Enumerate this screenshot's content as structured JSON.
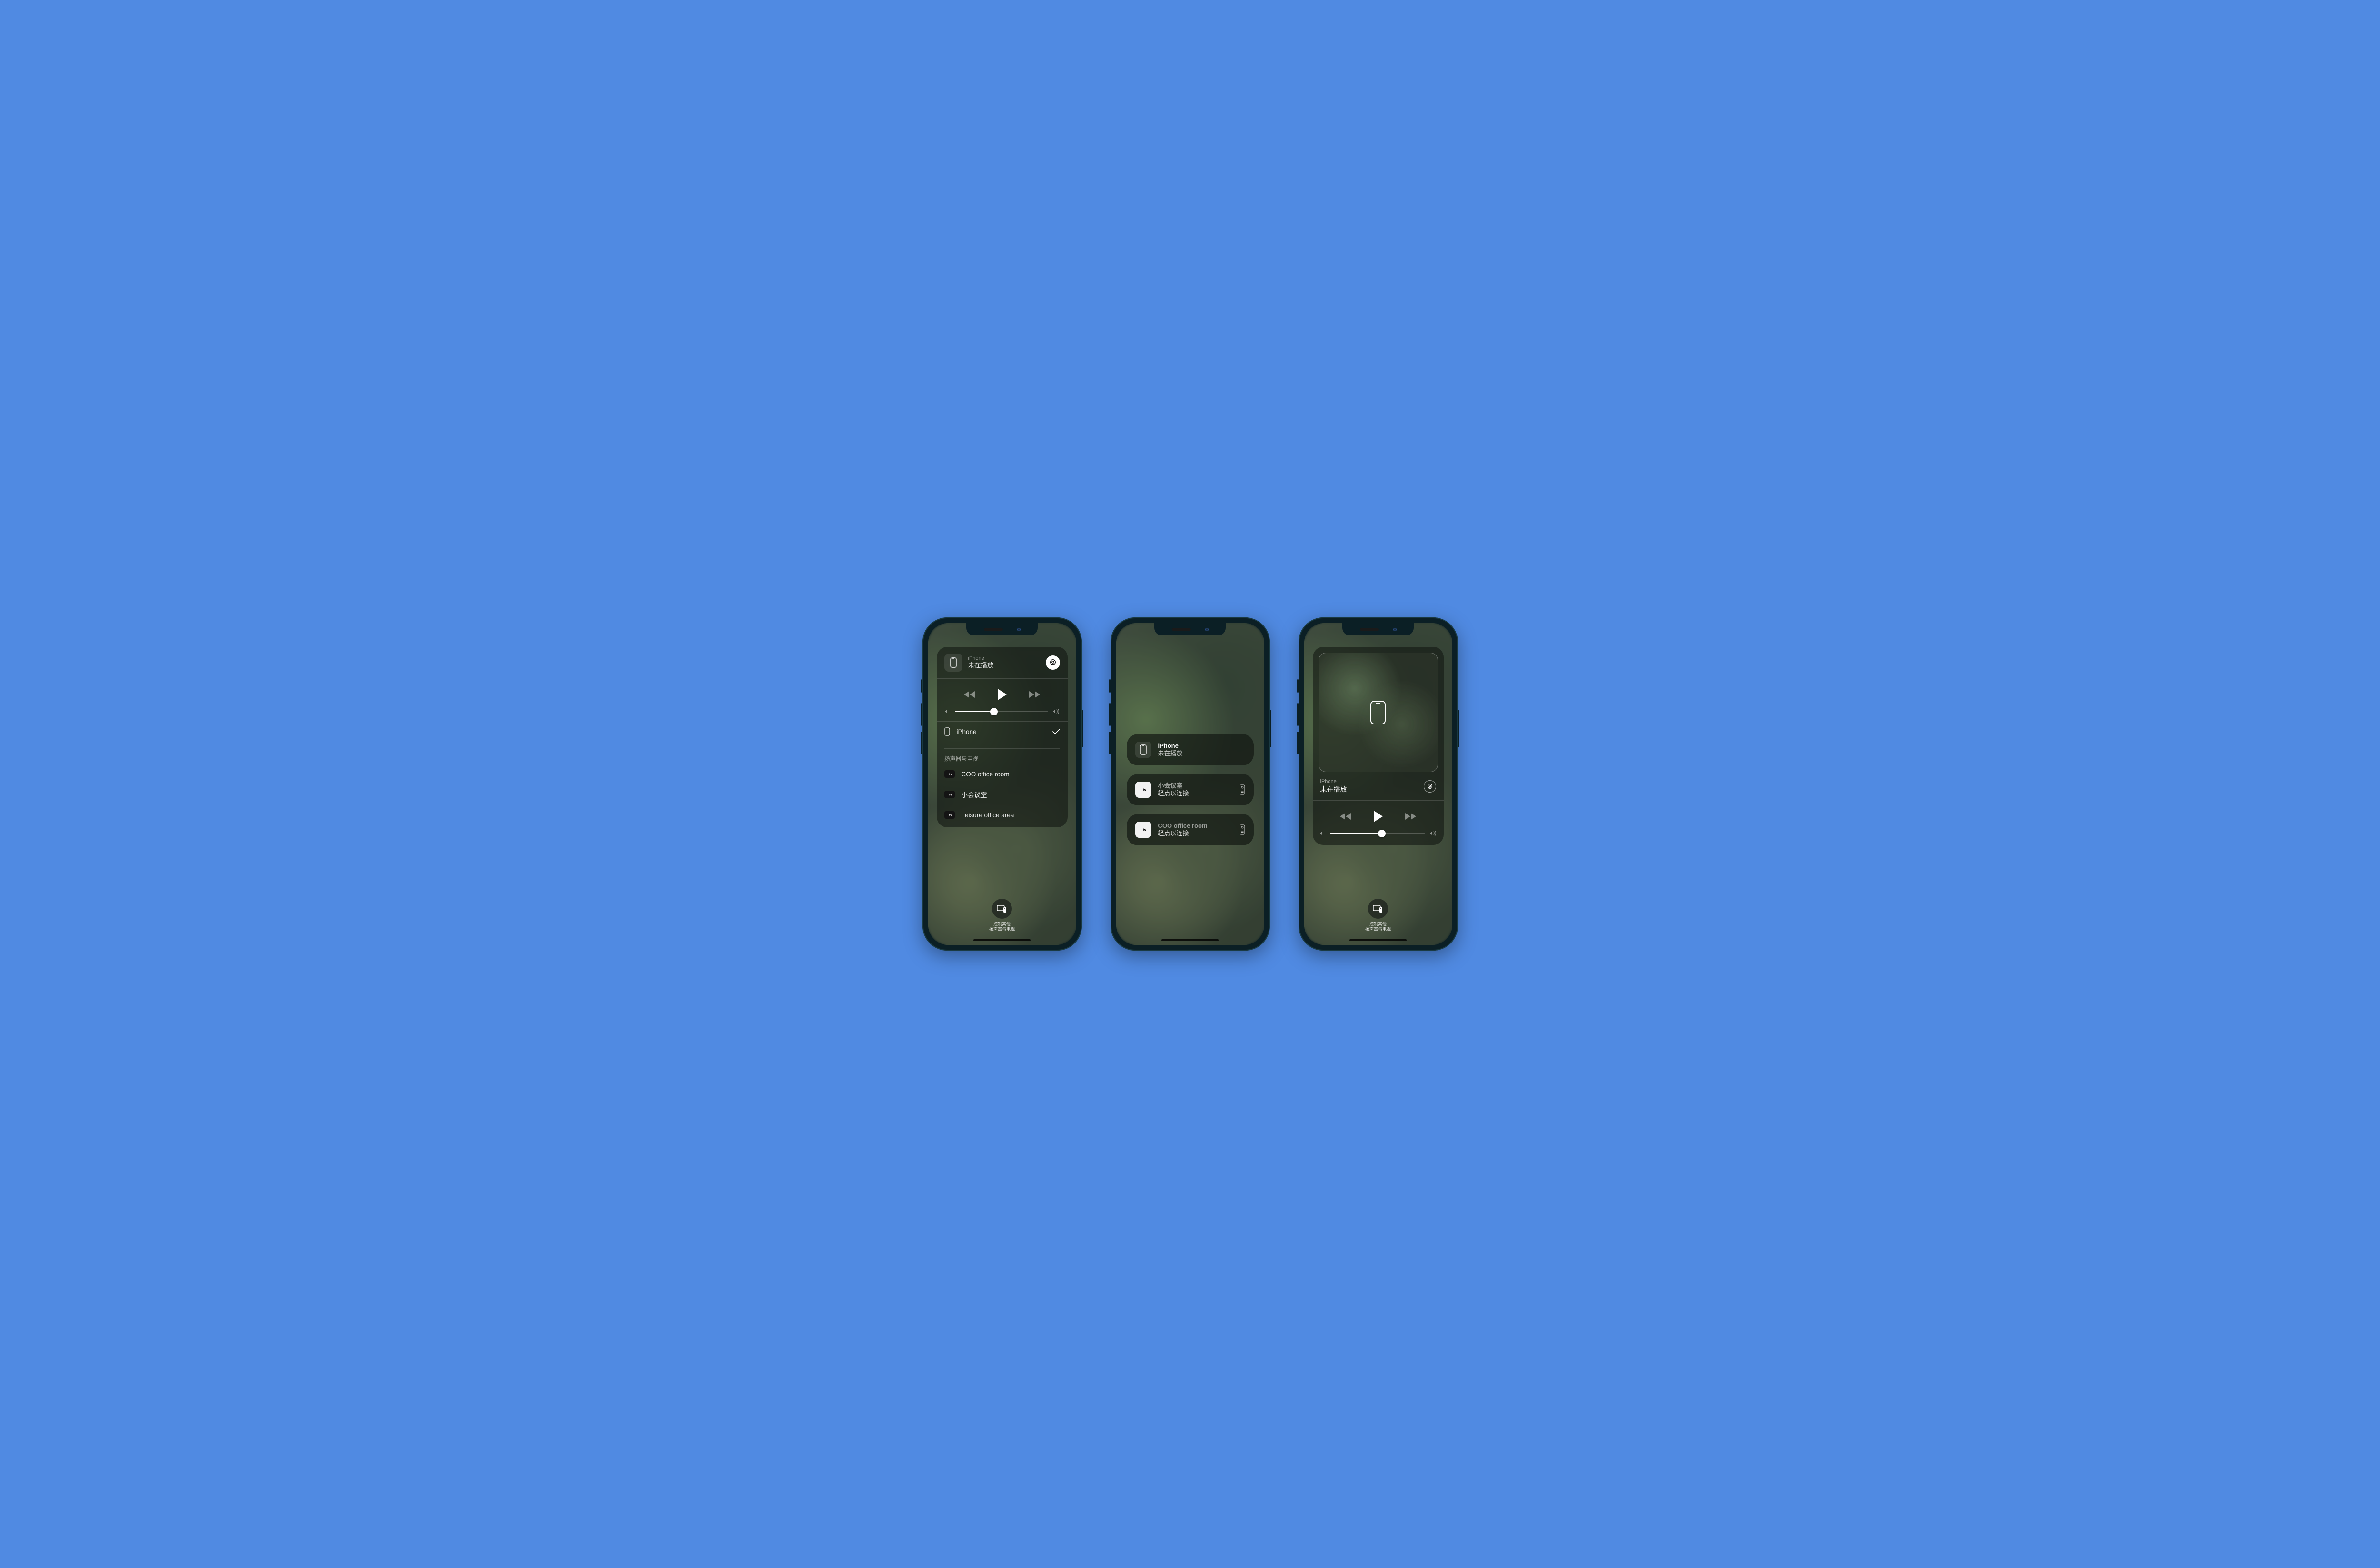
{
  "phone1": {
    "now_playing": {
      "device": "iPhone",
      "status": "未在播放"
    },
    "volume_percent": 42,
    "current_route": "iPhone",
    "speakers_section_label": "扬声器与电视",
    "routes": [
      {
        "label": "COO office room"
      },
      {
        "label": "小会议室"
      },
      {
        "label": "Leisure office area"
      }
    ],
    "control_other": {
      "line1": "控制其他",
      "line2": "扬声器与电视"
    }
  },
  "phone2": {
    "tiles": [
      {
        "kind": "iphone",
        "title": "iPhone",
        "sub": "未在播放"
      },
      {
        "kind": "tv",
        "title": "小会议室",
        "sub": "轻点以连接"
      },
      {
        "kind": "tv",
        "title": "COO office room",
        "sub": "轻点以连接"
      }
    ]
  },
  "phone3": {
    "now_playing": {
      "device": "iPhone",
      "status": "未在播放"
    },
    "volume_percent": 55,
    "control_other": {
      "line1": "控制其他",
      "line2": "扬声器与电视"
    }
  }
}
